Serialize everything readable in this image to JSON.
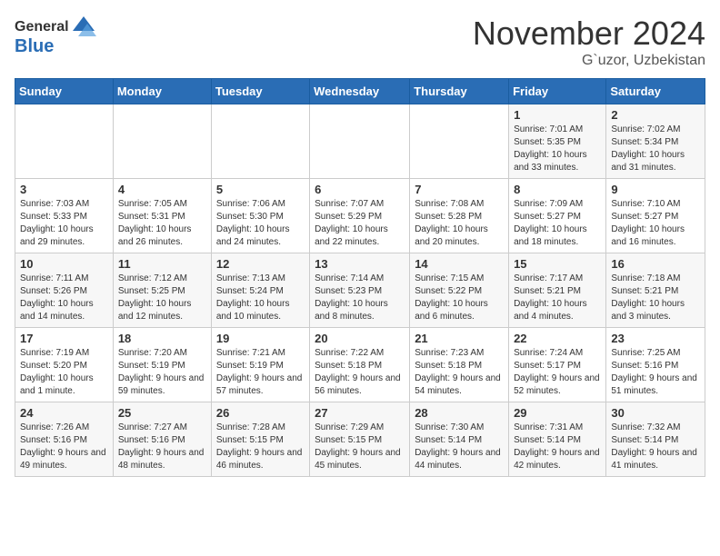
{
  "header": {
    "logo_general": "General",
    "logo_blue": "Blue",
    "title": "November 2024",
    "location": "G`uzor, Uzbekistan"
  },
  "days_of_week": [
    "Sunday",
    "Monday",
    "Tuesday",
    "Wednesday",
    "Thursday",
    "Friday",
    "Saturday"
  ],
  "weeks": [
    [
      {
        "day": "",
        "info": ""
      },
      {
        "day": "",
        "info": ""
      },
      {
        "day": "",
        "info": ""
      },
      {
        "day": "",
        "info": ""
      },
      {
        "day": "",
        "info": ""
      },
      {
        "day": "1",
        "info": "Sunrise: 7:01 AM\nSunset: 5:35 PM\nDaylight: 10 hours and 33 minutes."
      },
      {
        "day": "2",
        "info": "Sunrise: 7:02 AM\nSunset: 5:34 PM\nDaylight: 10 hours and 31 minutes."
      }
    ],
    [
      {
        "day": "3",
        "info": "Sunrise: 7:03 AM\nSunset: 5:33 PM\nDaylight: 10 hours and 29 minutes."
      },
      {
        "day": "4",
        "info": "Sunrise: 7:05 AM\nSunset: 5:31 PM\nDaylight: 10 hours and 26 minutes."
      },
      {
        "day": "5",
        "info": "Sunrise: 7:06 AM\nSunset: 5:30 PM\nDaylight: 10 hours and 24 minutes."
      },
      {
        "day": "6",
        "info": "Sunrise: 7:07 AM\nSunset: 5:29 PM\nDaylight: 10 hours and 22 minutes."
      },
      {
        "day": "7",
        "info": "Sunrise: 7:08 AM\nSunset: 5:28 PM\nDaylight: 10 hours and 20 minutes."
      },
      {
        "day": "8",
        "info": "Sunrise: 7:09 AM\nSunset: 5:27 PM\nDaylight: 10 hours and 18 minutes."
      },
      {
        "day": "9",
        "info": "Sunrise: 7:10 AM\nSunset: 5:27 PM\nDaylight: 10 hours and 16 minutes."
      }
    ],
    [
      {
        "day": "10",
        "info": "Sunrise: 7:11 AM\nSunset: 5:26 PM\nDaylight: 10 hours and 14 minutes."
      },
      {
        "day": "11",
        "info": "Sunrise: 7:12 AM\nSunset: 5:25 PM\nDaylight: 10 hours and 12 minutes."
      },
      {
        "day": "12",
        "info": "Sunrise: 7:13 AM\nSunset: 5:24 PM\nDaylight: 10 hours and 10 minutes."
      },
      {
        "day": "13",
        "info": "Sunrise: 7:14 AM\nSunset: 5:23 PM\nDaylight: 10 hours and 8 minutes."
      },
      {
        "day": "14",
        "info": "Sunrise: 7:15 AM\nSunset: 5:22 PM\nDaylight: 10 hours and 6 minutes."
      },
      {
        "day": "15",
        "info": "Sunrise: 7:17 AM\nSunset: 5:21 PM\nDaylight: 10 hours and 4 minutes."
      },
      {
        "day": "16",
        "info": "Sunrise: 7:18 AM\nSunset: 5:21 PM\nDaylight: 10 hours and 3 minutes."
      }
    ],
    [
      {
        "day": "17",
        "info": "Sunrise: 7:19 AM\nSunset: 5:20 PM\nDaylight: 10 hours and 1 minute."
      },
      {
        "day": "18",
        "info": "Sunrise: 7:20 AM\nSunset: 5:19 PM\nDaylight: 9 hours and 59 minutes."
      },
      {
        "day": "19",
        "info": "Sunrise: 7:21 AM\nSunset: 5:19 PM\nDaylight: 9 hours and 57 minutes."
      },
      {
        "day": "20",
        "info": "Sunrise: 7:22 AM\nSunset: 5:18 PM\nDaylight: 9 hours and 56 minutes."
      },
      {
        "day": "21",
        "info": "Sunrise: 7:23 AM\nSunset: 5:18 PM\nDaylight: 9 hours and 54 minutes."
      },
      {
        "day": "22",
        "info": "Sunrise: 7:24 AM\nSunset: 5:17 PM\nDaylight: 9 hours and 52 minutes."
      },
      {
        "day": "23",
        "info": "Sunrise: 7:25 AM\nSunset: 5:16 PM\nDaylight: 9 hours and 51 minutes."
      }
    ],
    [
      {
        "day": "24",
        "info": "Sunrise: 7:26 AM\nSunset: 5:16 PM\nDaylight: 9 hours and 49 minutes."
      },
      {
        "day": "25",
        "info": "Sunrise: 7:27 AM\nSunset: 5:16 PM\nDaylight: 9 hours and 48 minutes."
      },
      {
        "day": "26",
        "info": "Sunrise: 7:28 AM\nSunset: 5:15 PM\nDaylight: 9 hours and 46 minutes."
      },
      {
        "day": "27",
        "info": "Sunrise: 7:29 AM\nSunset: 5:15 PM\nDaylight: 9 hours and 45 minutes."
      },
      {
        "day": "28",
        "info": "Sunrise: 7:30 AM\nSunset: 5:14 PM\nDaylight: 9 hours and 44 minutes."
      },
      {
        "day": "29",
        "info": "Sunrise: 7:31 AM\nSunset: 5:14 PM\nDaylight: 9 hours and 42 minutes."
      },
      {
        "day": "30",
        "info": "Sunrise: 7:32 AM\nSunset: 5:14 PM\nDaylight: 9 hours and 41 minutes."
      }
    ]
  ]
}
